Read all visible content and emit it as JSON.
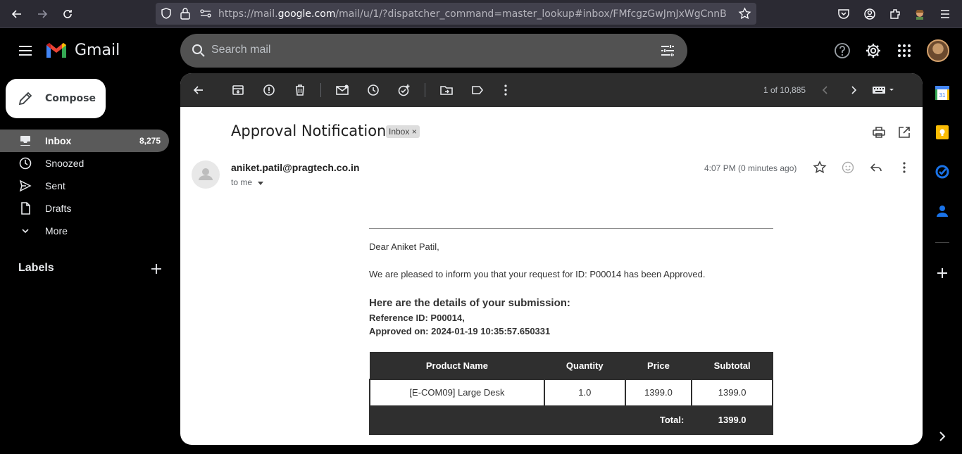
{
  "browser": {
    "url_prefix": "https://mail.",
    "url_domain": "google.com",
    "url_suffix": "/mail/u/1/?dispatcher_command=master_lookup#inbox/FMfcgzGwJmJxWgCnnB"
  },
  "app": {
    "name": "Gmail"
  },
  "search": {
    "placeholder": "Search mail"
  },
  "compose": {
    "label": "Compose"
  },
  "sidebar": {
    "items": [
      {
        "label": "Inbox",
        "count": "8,275",
        "icon": "inbox-icon",
        "active": true
      },
      {
        "label": "Snoozed",
        "icon": "clock-icon"
      },
      {
        "label": "Sent",
        "icon": "send-icon"
      },
      {
        "label": "Drafts",
        "icon": "draft-icon"
      },
      {
        "label": "More",
        "icon": "chevron-down-icon"
      }
    ],
    "labels_title": "Labels"
  },
  "toolbar": {
    "pager": "1 of 10,885"
  },
  "message": {
    "subject": "Approval Notification",
    "chip": "Inbox ×",
    "sender": "aniket.patil@pragtech.co.in",
    "to": "to me",
    "time": "4:07 PM (0 minutes ago)",
    "greeting": "Dear Aniket Patil,",
    "intro": "We are pleased to inform you that your request for ID: P00014 has been Approved.",
    "details_heading": "Here are the details of your submission:",
    "reference": "Reference ID: P00014,",
    "approved_on": "Approved on: 2024-01-19 10:35:57.650331",
    "table": {
      "headers": [
        "Product Name",
        "Quantity",
        "Price",
        "Subtotal"
      ],
      "rows": [
        [
          "[E-COM09] Large Desk",
          "1.0",
          "1399.0",
          "1399.0"
        ]
      ],
      "total_label": "Total:",
      "total_value": "1399.0"
    }
  },
  "colors": {
    "accent_blue": "#1a73e8",
    "panel_bg": "#2d2d2d",
    "table_dark": "#2f2f2f"
  }
}
